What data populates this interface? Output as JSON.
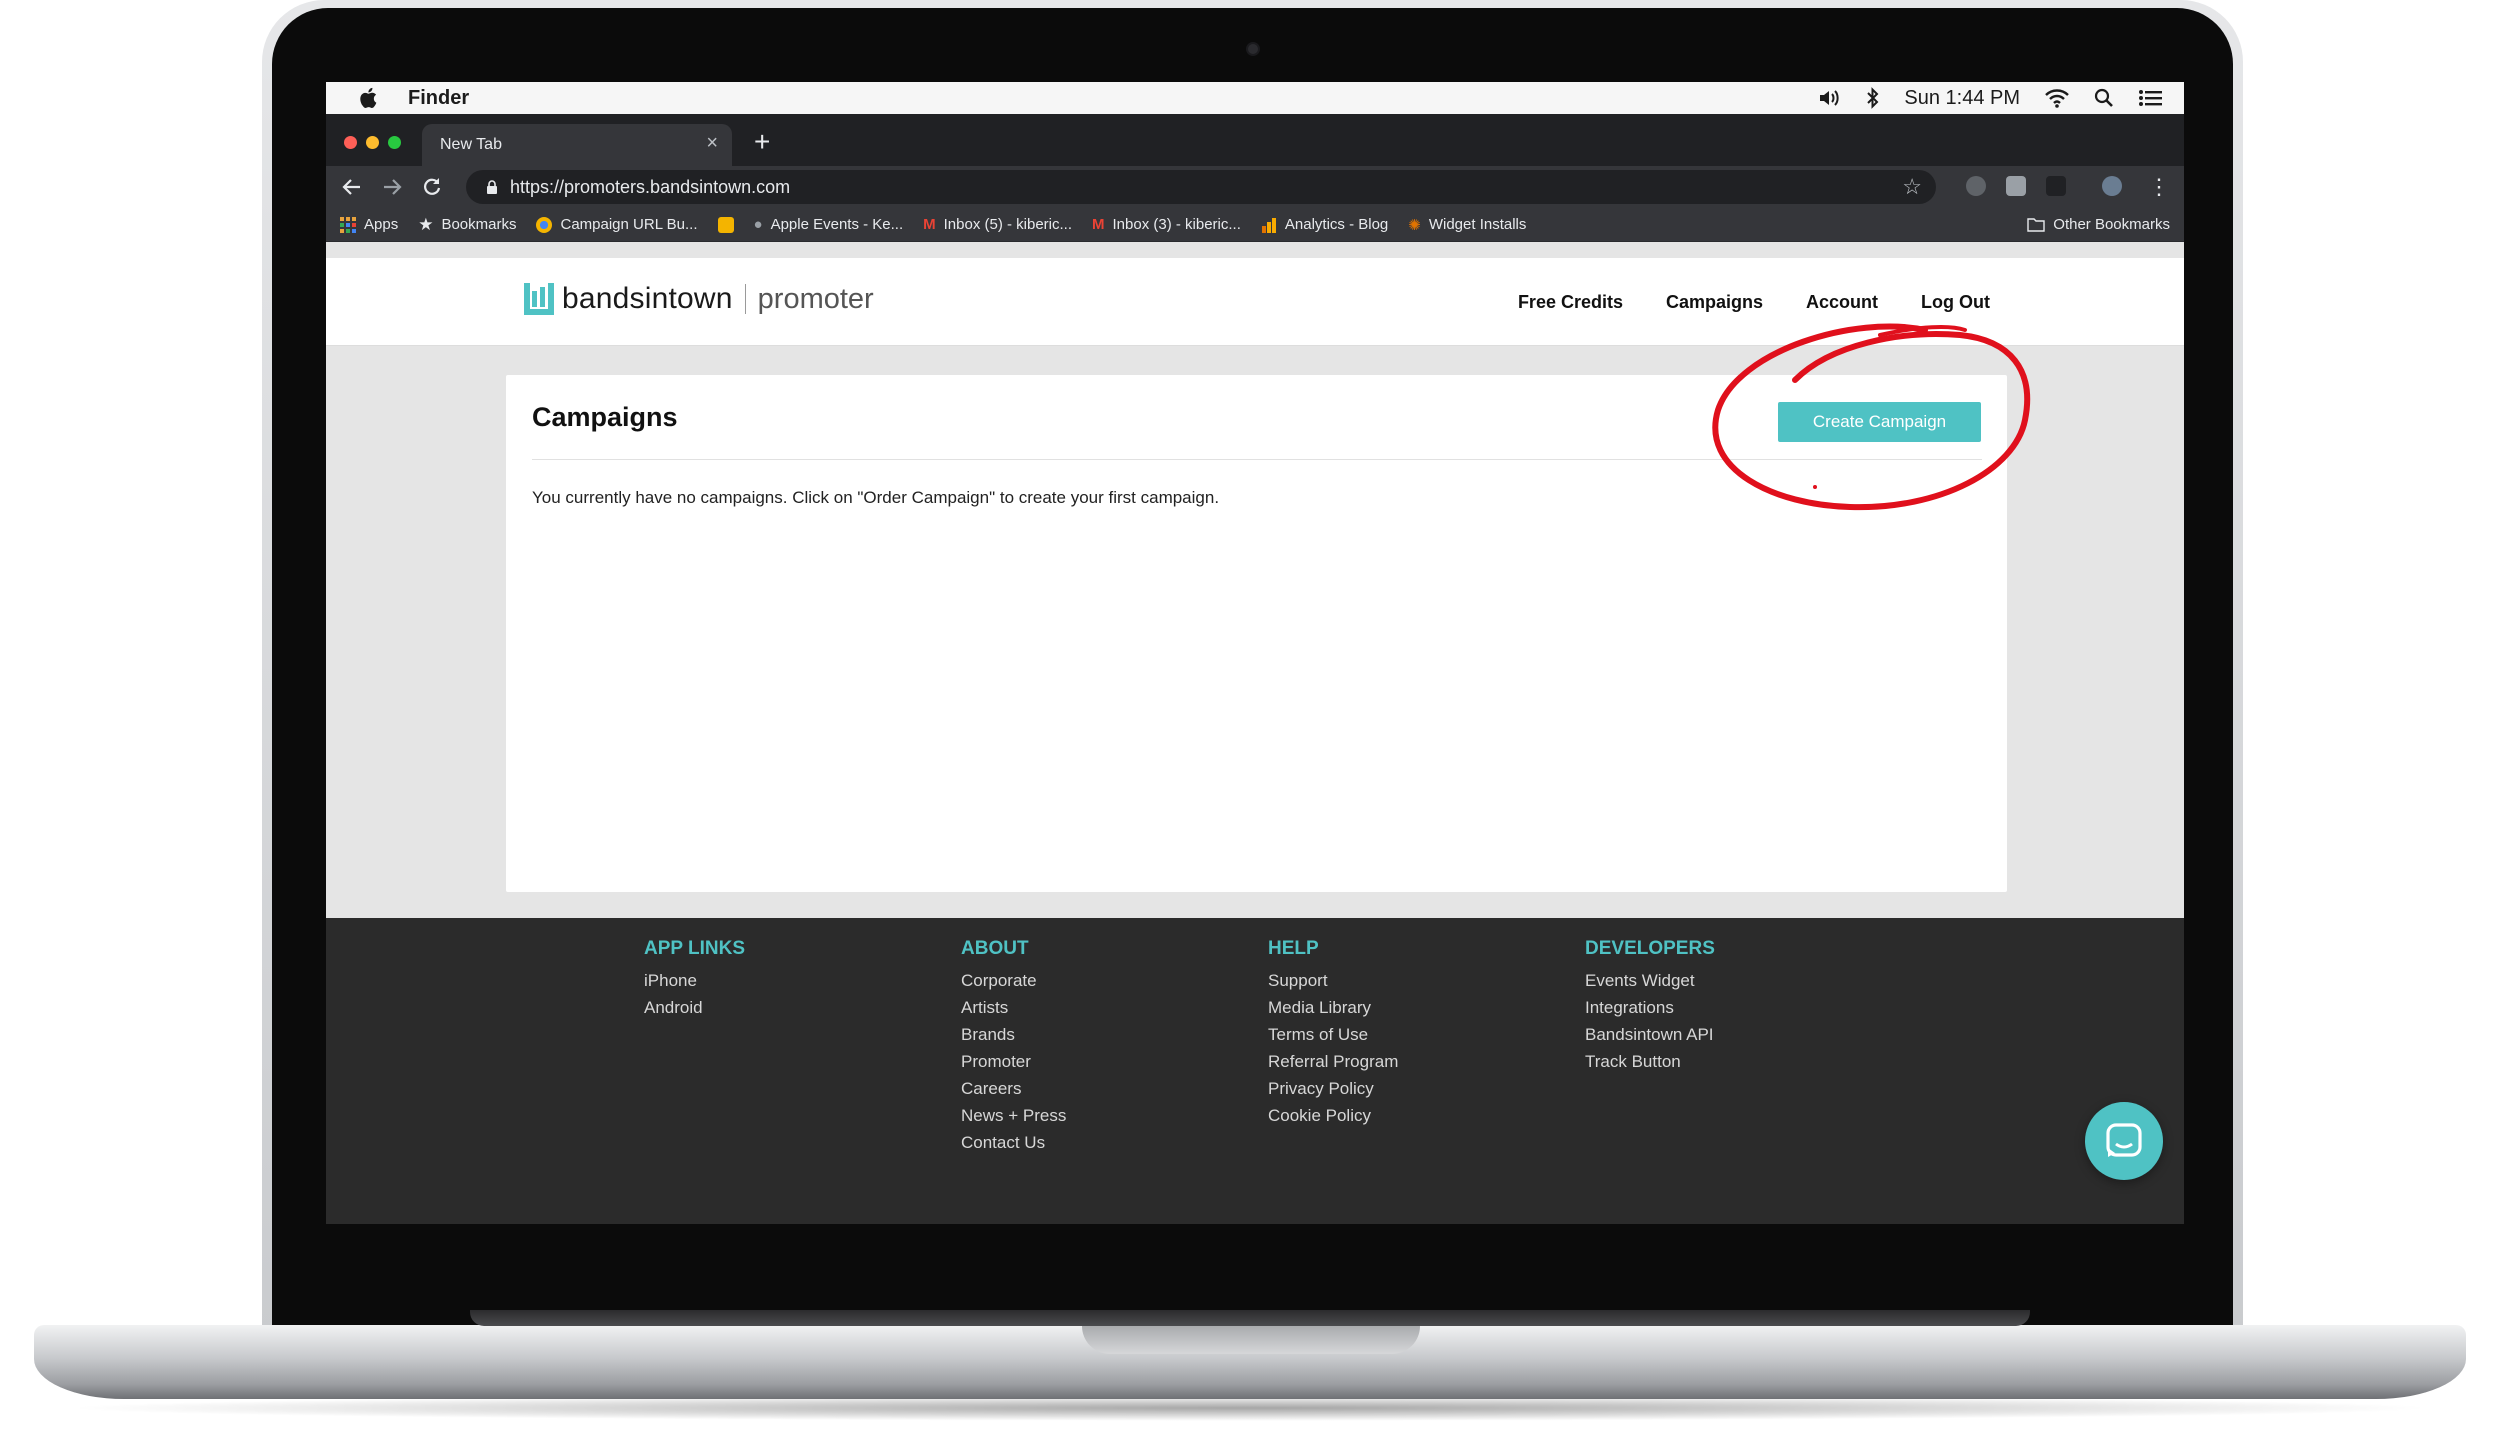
{
  "menubar": {
    "app_name": "Finder",
    "clock": "Sun 1:44 PM",
    "icons": [
      "apple-icon",
      "volume-icon",
      "bluetooth-icon",
      "wifi-icon",
      "spotlight-icon",
      "control-center-icon"
    ]
  },
  "browser": {
    "tab_title": "New Tab",
    "new_tab_symbol": "+",
    "close_symbol": "×",
    "url": "https://promoters.bandsintown.com",
    "bookmarks": [
      {
        "label": "Apps",
        "icon": "apps-grid-icon",
        "color": "#e8a33d"
      },
      {
        "label": "Bookmarks",
        "icon": "star-icon",
        "color": "#e8eaed"
      },
      {
        "label": "Campaign URL Bu...",
        "icon": "globe-icon",
        "color": "#f4b400"
      },
      {
        "label": "",
        "icon": "slides-icon",
        "color": "#f4b400"
      },
      {
        "label": "Apple Events - Ke...",
        "icon": "apple-icon",
        "color": "#9aa0a6"
      },
      {
        "label": "Inbox (5) - kiberic...",
        "icon": "gmail-icon",
        "color": "#ea4335"
      },
      {
        "label": "Inbox (3) - kiberic...",
        "icon": "gmail-icon",
        "color": "#ea4335"
      },
      {
        "label": "Analytics - Blog",
        "icon": "analytics-icon",
        "color": "#f9ab00"
      },
      {
        "label": "Widget Installs",
        "icon": "widget-icon",
        "color": "#e37400"
      }
    ],
    "other_bookmarks": "Other Bookmarks"
  },
  "site": {
    "brand": "bandsintown",
    "brand_sub": "promoter",
    "brand_color": "#4fc2c4",
    "nav": [
      "Free Credits",
      "Campaigns",
      "Account",
      "Log Out"
    ]
  },
  "main": {
    "title": "Campaigns",
    "create_button": "Create Campaign",
    "empty_message": "You currently have no campaigns. Click on \"Order Campaign\" to create your first campaign."
  },
  "footer": {
    "columns": [
      {
        "heading": "APP LINKS",
        "links": [
          "iPhone",
          "Android"
        ]
      },
      {
        "heading": "ABOUT",
        "links": [
          "Corporate",
          "Artists",
          "Brands",
          "Promoter",
          "Careers",
          "News + Press",
          "Contact Us"
        ]
      },
      {
        "heading": "HELP",
        "links": [
          "Support",
          "Media Library",
          "Terms of Use",
          "Referral Program",
          "Privacy Policy",
          "Cookie Policy"
        ]
      },
      {
        "heading": "DEVELOPERS",
        "links": [
          "Events Widget",
          "Integrations",
          "Bandsintown API",
          "Track Button"
        ]
      }
    ]
  },
  "annotation_color": "#e0101c"
}
